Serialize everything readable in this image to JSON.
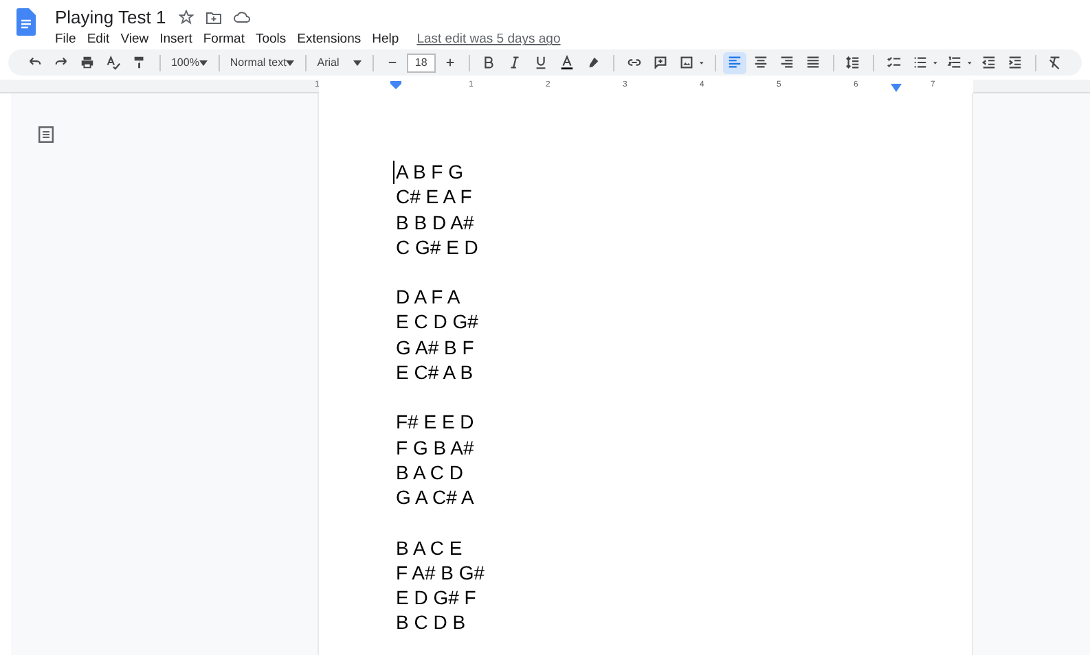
{
  "document": {
    "title": "Playing Test 1",
    "starred": false
  },
  "menu": [
    "File",
    "Edit",
    "View",
    "Insert",
    "Format",
    "Tools",
    "Extensions",
    "Help"
  ],
  "last_edit": "Last edit was 5 days ago",
  "toolbar": {
    "zoom": "100%",
    "style": "Normal text",
    "font": "Arial",
    "font_size": "18",
    "alignments": [
      {
        "kind": "left",
        "selected": true
      },
      {
        "kind": "center",
        "selected": false
      },
      {
        "kind": "right",
        "selected": false
      },
      {
        "kind": "justify",
        "selected": false
      }
    ]
  },
  "ruler": [
    "1",
    "1",
    "2",
    "3",
    "4",
    "5",
    "6",
    "7"
  ],
  "page": {
    "stanzas": [
      [
        "A B F G",
        "C# E A F",
        "B B D A#",
        "C G# E D"
      ],
      [
        "D A F A",
        "E C D G#",
        "G A# B F",
        "E C# A B"
      ],
      [
        "F# E E D",
        "F G B A#",
        "B A C D",
        "G A C# A"
      ],
      [
        "B A C E",
        "F A# B G#",
        "E D G# F",
        "B C D B"
      ]
    ]
  }
}
